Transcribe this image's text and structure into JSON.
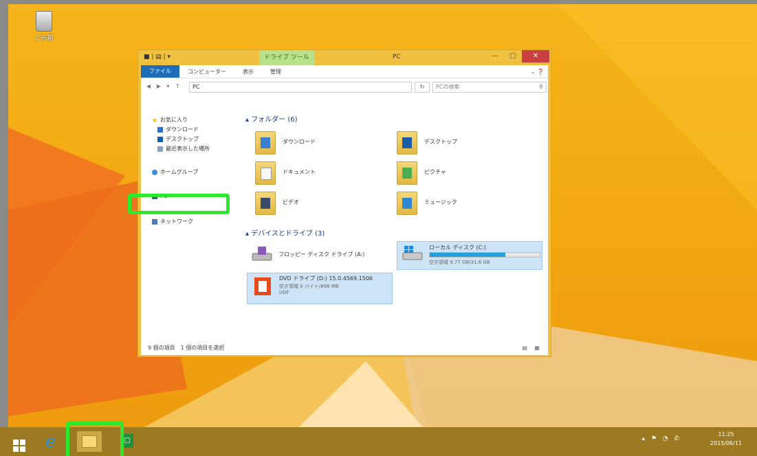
{
  "desktop": {
    "recycle_bin_label": "ごみ箱"
  },
  "window": {
    "title": "PC",
    "qat": "■ | ▤ | ▾",
    "context_tab": "ドライブ ツール",
    "controls": {
      "minimize": "—",
      "maximize": "□",
      "close": "✕"
    },
    "ribbon_tabs": [
      "ファイル",
      "コンピューター",
      "表示",
      "管理"
    ],
    "address": {
      "nav": "◀ ▶ ▾ ↑",
      "path": "PC",
      "refresh": "↻",
      "search_placeholder": "PCの検索"
    },
    "nav_pane": [
      "お気に入り",
      "ダウンロード",
      "デスクトップ",
      "最近表示した場所",
      "ホームグループ",
      "PC",
      "ネットワーク"
    ],
    "groups": {
      "folders": "フォルダー (6)",
      "devices": "デバイスとドライブ (3)"
    },
    "folders": [
      "ダウンロード",
      "デスクトップ",
      "ドキュメント",
      "ピクチャ",
      "ビデオ",
      "ミュージック"
    ],
    "drives": {
      "floppy": {
        "name": "フロッピー ディスク ドライブ (A:)"
      },
      "local": {
        "name": "ローカル ディスク (C:)",
        "space": "空き領域 9.77 GB/31.6 GB",
        "used_fraction": 0.69
      },
      "dvd": {
        "name": "DVD ドライブ (D:) 15.0.4569.1506",
        "space": "空き領域 0 バイト/896 MB",
        "fs": "UDF"
      }
    },
    "status": {
      "items": "9 個の項目",
      "selected": "1 個の項目を選択",
      "views": "▤ ▦"
    }
  },
  "taskbar": {
    "time": "11:25",
    "date": "2015/06/11",
    "tray": "▴ ⚑ ◔ ✆"
  },
  "colors": {
    "highlight": "#2ee82e",
    "accent": "#1e6bb8"
  }
}
